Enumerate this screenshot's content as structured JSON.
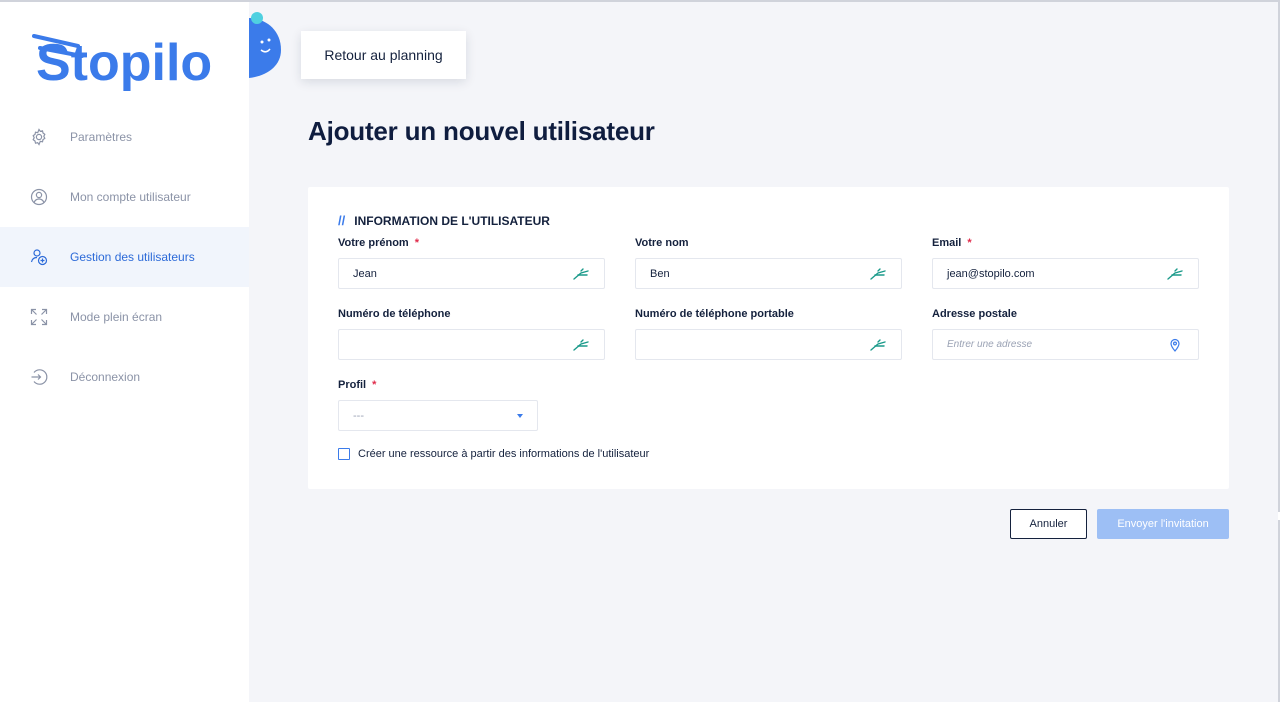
{
  "brand": {
    "name": "Stopilo",
    "color": "#3b7bea"
  },
  "sidebar": {
    "items": [
      {
        "label": "Paramètres",
        "icon": "gear-icon",
        "active": false
      },
      {
        "label": "Mon compte utilisateur",
        "icon": "user-circle-icon",
        "active": false
      },
      {
        "label": "Gestion des utilisateurs",
        "icon": "user-add-icon",
        "active": true
      },
      {
        "label": "Mode plein écran",
        "icon": "fullscreen-icon",
        "active": false
      },
      {
        "label": "Déconnexion",
        "icon": "logout-icon",
        "active": false
      }
    ]
  },
  "header": {
    "back_label": "Retour au planning"
  },
  "page": {
    "title": "Ajouter un nouvel utilisateur"
  },
  "form": {
    "section_marker": "//",
    "section_title": "INFORMATION DE L'UTILISATEUR",
    "required_marker": "*",
    "first_name": {
      "label": "Votre prénom",
      "value": "Jean",
      "required": true
    },
    "last_name": {
      "label": "Votre nom",
      "value": "Ben",
      "required": false
    },
    "email": {
      "label": "Email",
      "value": "jean@stopilo.com",
      "required": true
    },
    "phone": {
      "label": "Numéro de téléphone",
      "value": ""
    },
    "mobile": {
      "label": "Numéro de téléphone portable",
      "value": ""
    },
    "address": {
      "label": "Adresse postale",
      "placeholder": "Entrer une adresse"
    },
    "profile": {
      "label": "Profil",
      "value": "---",
      "required": true
    },
    "create_resource": {
      "label": "Créer une ressource à partir des informations de l'utilisateur",
      "checked": false
    }
  },
  "actions": {
    "cancel_label": "Annuler",
    "send_label": "Envoyer l'invitation"
  },
  "colors": {
    "accent": "#3b7bea",
    "active_bg": "#f1f5fc",
    "disabled_button": "#9dbff5",
    "required": "#e02b4a"
  }
}
